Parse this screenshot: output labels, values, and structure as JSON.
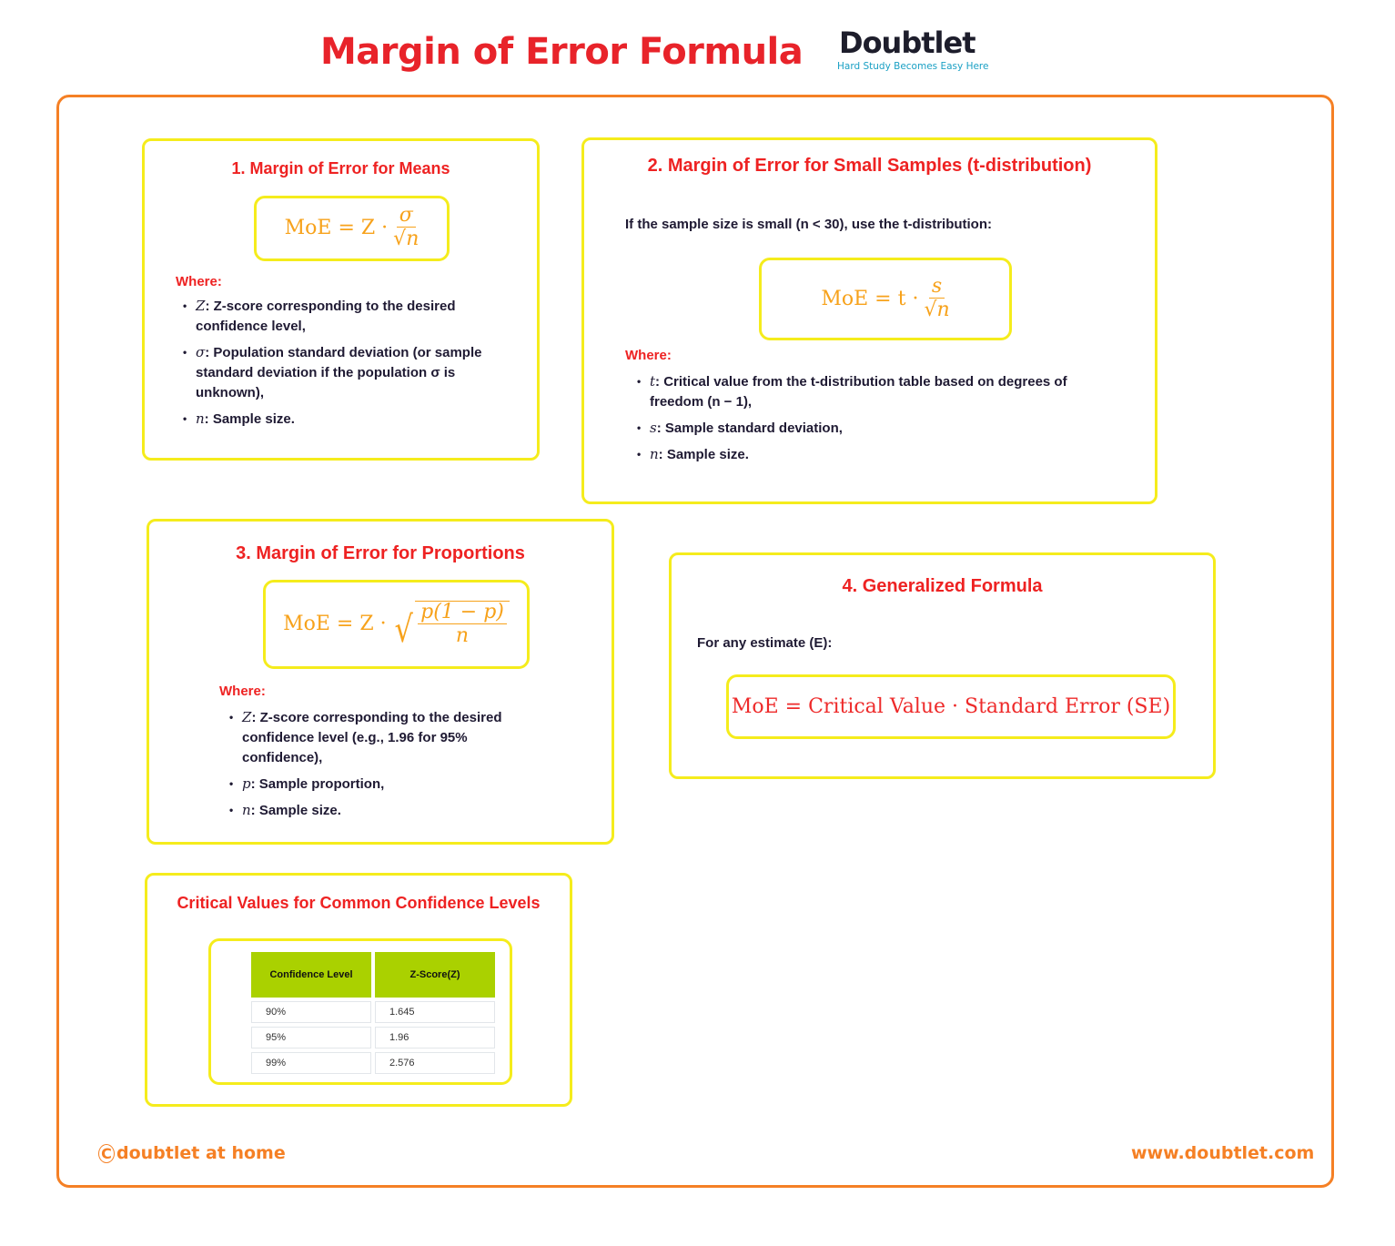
{
  "header": {
    "title": "Margin of Error Formula",
    "logo_word": "Doubtlet",
    "logo_tagline": "Hard Study Becomes Easy Here"
  },
  "theme": {
    "title_color": "#e8232a",
    "frame_color": "#f58025",
    "card_border": "#f5ec1c",
    "formula_color": "#f7a21b",
    "table_header": "#aad100"
  },
  "sections": [
    {
      "title": "1. Margin of Error for Means",
      "formula": {
        "lhs": "MoE = Z ·",
        "numerator": "σ",
        "denominator": "√n"
      },
      "where_label": "Where:",
      "bullets": [
        {
          "sym": "Z",
          "text": ": Z-score corresponding to the desired confidence level,"
        },
        {
          "sym": "σ",
          "text": ": Population standard deviation (or sample standard deviation if the population σ is unknown),"
        },
        {
          "sym": "n",
          "text": ": Sample size."
        }
      ]
    },
    {
      "title": "2. Margin of Error for Small Samples (t-distribution)",
      "intro": "If the sample size is small (n < 30), use the t-distribution:",
      "formula": {
        "lhs": "MoE = t ·",
        "numerator": "s",
        "denominator": "√n"
      },
      "where_label": "Where:",
      "bullets": [
        {
          "sym": "t",
          "text": ": Critical value from the t-distribution table based on degrees of freedom (n − 1),"
        },
        {
          "sym": "s",
          "text": ": Sample standard deviation,"
        },
        {
          "sym": "n",
          "text": ": Sample size."
        }
      ]
    },
    {
      "title": "3. Margin of Error for Proportions",
      "formula": {
        "lhs": "MoE = Z ·",
        "numerator": "p(1 − p)",
        "denominator": "n"
      },
      "where_label": "Where:",
      "bullets": [
        {
          "sym": "Z",
          "text": ": Z-score corresponding to the desired confidence level (e.g., 1.96 for 95% confidence),"
        },
        {
          "sym": "p",
          "text": ": Sample proportion,"
        },
        {
          "sym": "n",
          "text": ": Sample size."
        }
      ]
    },
    {
      "title": "4. Generalized Formula",
      "intro": "For any estimate (E):",
      "formula": {
        "text": "MoE = Critical Value · Standard Error (SE)"
      }
    }
  ],
  "critical_values": {
    "title": "Critical Values for Common Confidence Levels",
    "columns": [
      "Confidence Level",
      "Z-Score(Z)"
    ],
    "rows": [
      [
        "90%",
        "1.645"
      ],
      [
        "95%",
        "1.96"
      ],
      [
        "99%",
        "2.576"
      ]
    ]
  },
  "footer": {
    "copyright_symbol": "C",
    "left": "doubtlet at home",
    "right": "www.doubtlet.com"
  }
}
